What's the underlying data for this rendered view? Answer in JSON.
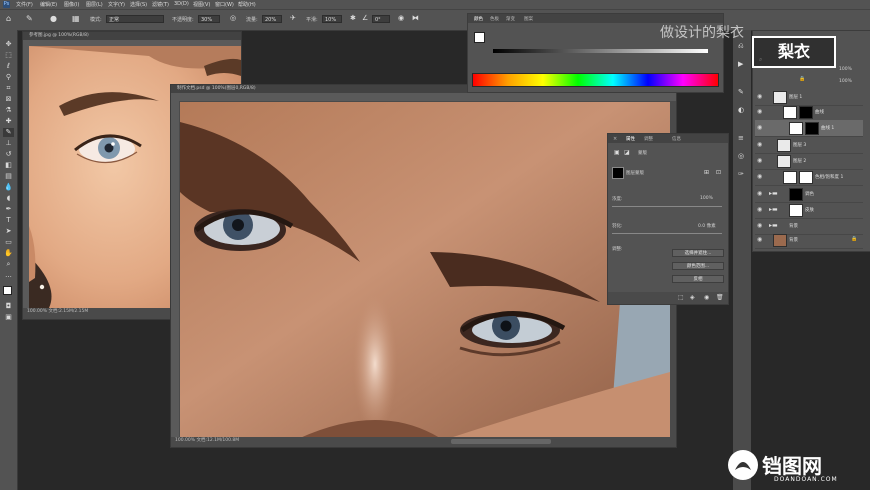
{
  "app": {
    "logo": "Ps"
  },
  "menu": [
    "文件(F)",
    "编辑(E)",
    "图像(I)",
    "图层(L)",
    "文字(Y)",
    "选择(S)",
    "滤镜(T)",
    "3D(D)",
    "视图(V)",
    "窗口(W)",
    "帮助(H)"
  ],
  "options_bar": {
    "mode_label": "模式:",
    "mode_value": "正常",
    "opacity_label": "不透明度:",
    "opacity_value": "30%",
    "flow_label": "流量:",
    "flow_value": "20%",
    "smooth_label": "平滑:",
    "smooth_value": "10%",
    "angle_value": "0°"
  },
  "doc_left": {
    "tab": "参考图.jpg @ 100%(RGB/8)",
    "status": "100.00%  文档:2.15M/2.15M"
  },
  "doc_main": {
    "tab": "制作文档.psd @ 100%(图层0,RGB/8)",
    "status": "100.00%  文档:12.1M/100.8M"
  },
  "color_panel": {
    "tabs": [
      "颜色",
      "色板",
      "渐变",
      "图案"
    ]
  },
  "properties_panel": {
    "tabs": [
      "属性",
      "调整",
      "信息"
    ],
    "mask_label": "蒙版",
    "layer_mask_label": "图层蒙版",
    "density_label": "浓度:",
    "density_value": "100%",
    "feather_label": "羽化:",
    "feather_value": "0.0 像素",
    "refine_label": "调整:",
    "btn_select_mask": "选择并遮住...",
    "btn_color_range": "颜色范围...",
    "btn_invert": "反相"
  },
  "layers_panel": {
    "opacity_value": "100%",
    "fill_value": "100%",
    "layers": [
      {
        "name": "图层 1"
      },
      {
        "name": "曲线"
      },
      {
        "name": "曲线 1"
      },
      {
        "name": "图层 3"
      },
      {
        "name": "图层 2"
      },
      {
        "name": "色相/饱和度 1"
      },
      {
        "name": "调色"
      },
      {
        "name": "皮肤"
      },
      {
        "name": "背景"
      },
      {
        "name": "背景"
      }
    ]
  },
  "watermark_top": "做设计的梨衣",
  "watermark_brand": "梨衣",
  "watermark_bottom": {
    "site": "铛图网",
    "domain": "DOANDOAN.COM"
  }
}
